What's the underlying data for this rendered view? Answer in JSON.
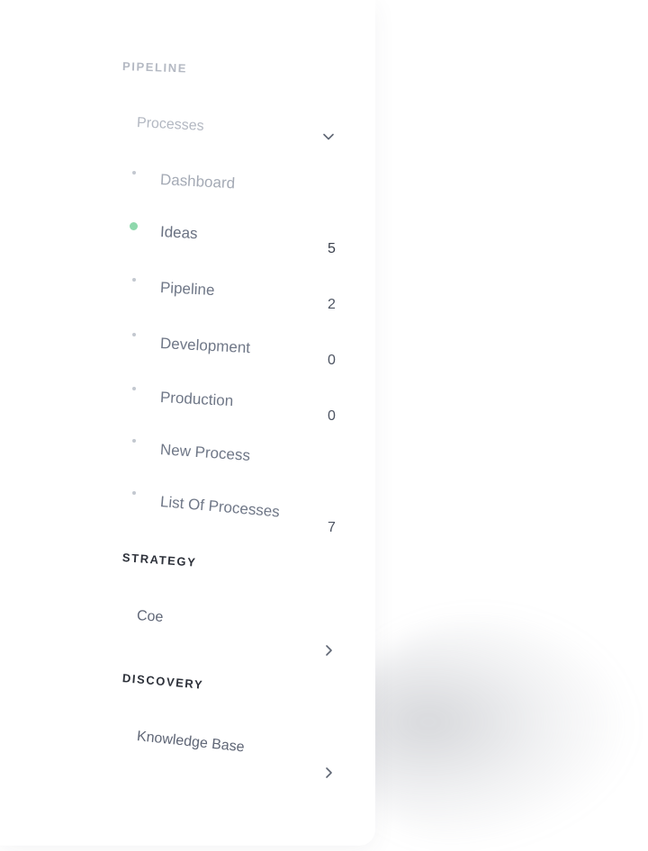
{
  "sections": {
    "pipeline": {
      "title": "PIPELINE",
      "group_label": "Processes",
      "group_icon": "chevron-down-icon",
      "items": [
        {
          "label": "Dashboard",
          "count": ""
        },
        {
          "label": "Ideas",
          "count": "5",
          "active": true
        },
        {
          "label": "Pipeline",
          "count": "2"
        },
        {
          "label": "Development",
          "count": "0"
        },
        {
          "label": "Production",
          "count": "0"
        },
        {
          "label": "New Process",
          "count": ""
        },
        {
          "label": "List Of Processes",
          "count": "7"
        }
      ]
    },
    "strategy": {
      "title": "STRATEGY",
      "items": [
        {
          "label": "Coe",
          "icon": "chevron-right-icon"
        }
      ]
    },
    "discovery": {
      "title": "DISCOVERY",
      "items": [
        {
          "label": "Knowledge Base",
          "icon": "chevron-right-icon"
        }
      ]
    }
  },
  "colors": {
    "active_dot": "#8ed8ac",
    "section_muted": "#b4b9c3",
    "section_dark": "#2d313a",
    "item_text": "#6f7787"
  }
}
